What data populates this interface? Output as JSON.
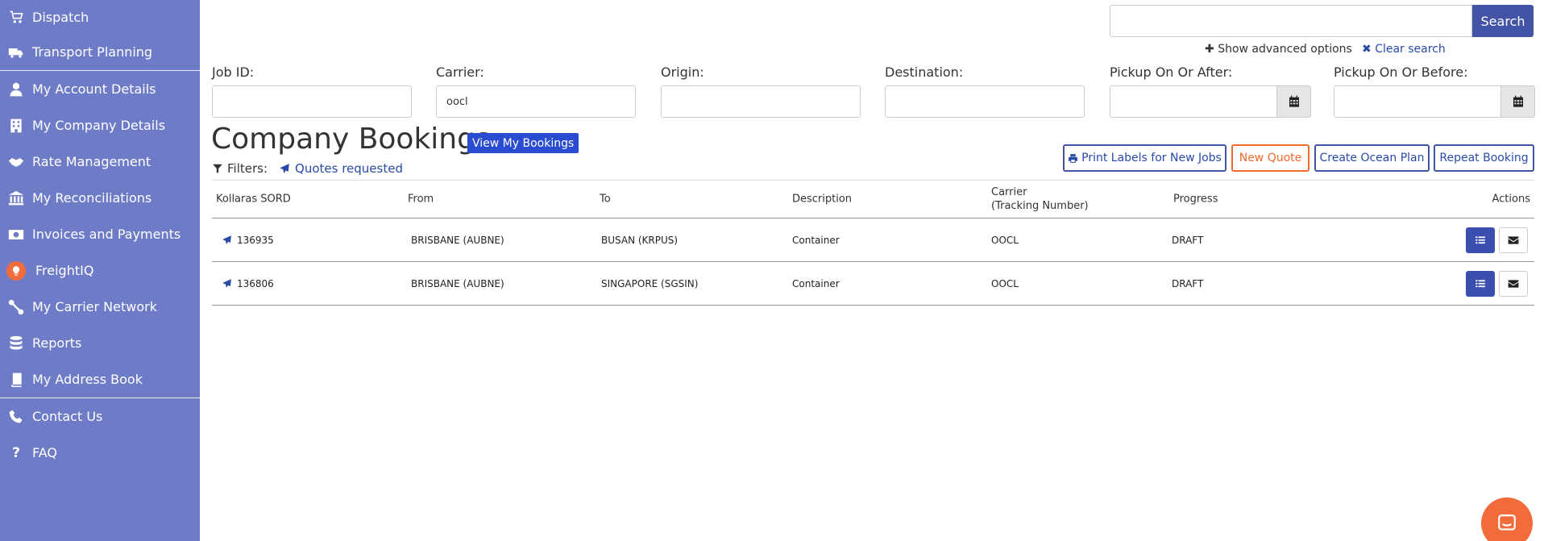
{
  "sidebar": {
    "items": [
      {
        "label": "Dispatch",
        "icon": "cart-icon"
      },
      {
        "label": "Transport Planning",
        "icon": "truck-icon"
      },
      {
        "label": "My Account Details",
        "icon": "user-icon"
      },
      {
        "label": "My Company Details",
        "icon": "building-icon"
      },
      {
        "label": "Rate Management",
        "icon": "handshake-icon"
      },
      {
        "label": "My Reconciliations",
        "icon": "bank-icon"
      },
      {
        "label": "Invoices and Payments",
        "icon": "money-icon"
      },
      {
        "label": "FreightIQ",
        "icon": "lightbulb-icon"
      },
      {
        "label": "My Carrier Network",
        "icon": "network-icon"
      },
      {
        "label": "Reports",
        "icon": "database-icon"
      },
      {
        "label": "My Address Book",
        "icon": "book-icon"
      },
      {
        "label": "Contact Us",
        "icon": "phone-icon"
      },
      {
        "label": "FAQ",
        "icon": "question-icon"
      }
    ]
  },
  "search": {
    "value": "",
    "button_label": "Search",
    "advanced_label": "Show advanced options",
    "clear_label": "Clear search"
  },
  "filters_form": {
    "job_id": {
      "label": "Job ID:",
      "value": ""
    },
    "carrier": {
      "label": "Carrier:",
      "value": "oocl"
    },
    "origin": {
      "label": "Origin:",
      "value": ""
    },
    "destination": {
      "label": "Destination:",
      "value": ""
    },
    "pickup_after": {
      "label": "Pickup On Or After:",
      "value": ""
    },
    "pickup_before": {
      "label": "Pickup On Or Before:",
      "value": ""
    }
  },
  "heading": {
    "title": "Company Bookings",
    "view_my_label": "View My Bookings"
  },
  "filters": {
    "label": "Filters:",
    "tag": "Quotes requested"
  },
  "actions": {
    "print_labels": "Print Labels for New Jobs",
    "new_quote": "New Quote",
    "create_ocean_plan": "Create Ocean Plan",
    "repeat_booking": "Repeat Booking"
  },
  "table": {
    "headers": {
      "sord": "Kollaras SORD",
      "from": "From",
      "to": "To",
      "description": "Description",
      "carrier": "Carrier",
      "tracking": "(Tracking Number)",
      "progress": "Progress",
      "actions": "Actions"
    },
    "rows": [
      {
        "sord": "136935",
        "from": "BRISBANE (AUBNE)",
        "to": "BUSAN (KRPUS)",
        "description": "Container",
        "carrier": "OOCL",
        "progress": "DRAFT"
      },
      {
        "sord": "136806",
        "from": "BRISBANE (AUBNE)",
        "to": "SINGAPORE (SGSIN)",
        "description": "Container",
        "carrier": "OOCL",
        "progress": "DRAFT"
      }
    ]
  },
  "colors": {
    "sidebar": "#6e7cc8",
    "primary": "#4354a6",
    "accent": "#f2692d"
  }
}
